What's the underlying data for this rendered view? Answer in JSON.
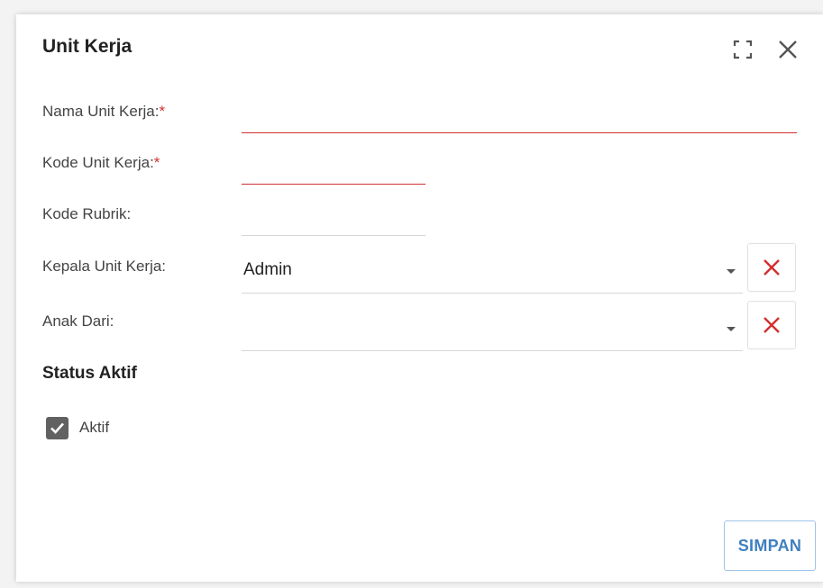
{
  "dialog": {
    "title": "Unit Kerja"
  },
  "form": {
    "nama_unit_kerja": {
      "label": "Nama Unit Kerja:",
      "required_mark": "*",
      "value": ""
    },
    "kode_unit_kerja": {
      "label": "Kode Unit Kerja:",
      "required_mark": "*",
      "value": ""
    },
    "kode_rubrik": {
      "label": "Kode Rubrik:",
      "value": ""
    },
    "kepala_unit_kerja": {
      "label": "Kepala Unit Kerja:",
      "selected": "Admin"
    },
    "anak_dari": {
      "label": "Anak Dari:",
      "selected": ""
    },
    "status": {
      "heading": "Status Aktif",
      "aktif_label": "Aktif",
      "aktif_checked": true
    }
  },
  "footer": {
    "save_label": "SIMPAN"
  },
  "icons": {
    "maximize": "maximize-icon",
    "close": "close-icon",
    "clear": "clear-x-icon",
    "dropdown": "caret-down-icon",
    "check": "check-icon"
  },
  "colors": {
    "error": "#d32f2f",
    "primary_text": "#3f7fbf",
    "checkbox_fill": "#616161"
  }
}
